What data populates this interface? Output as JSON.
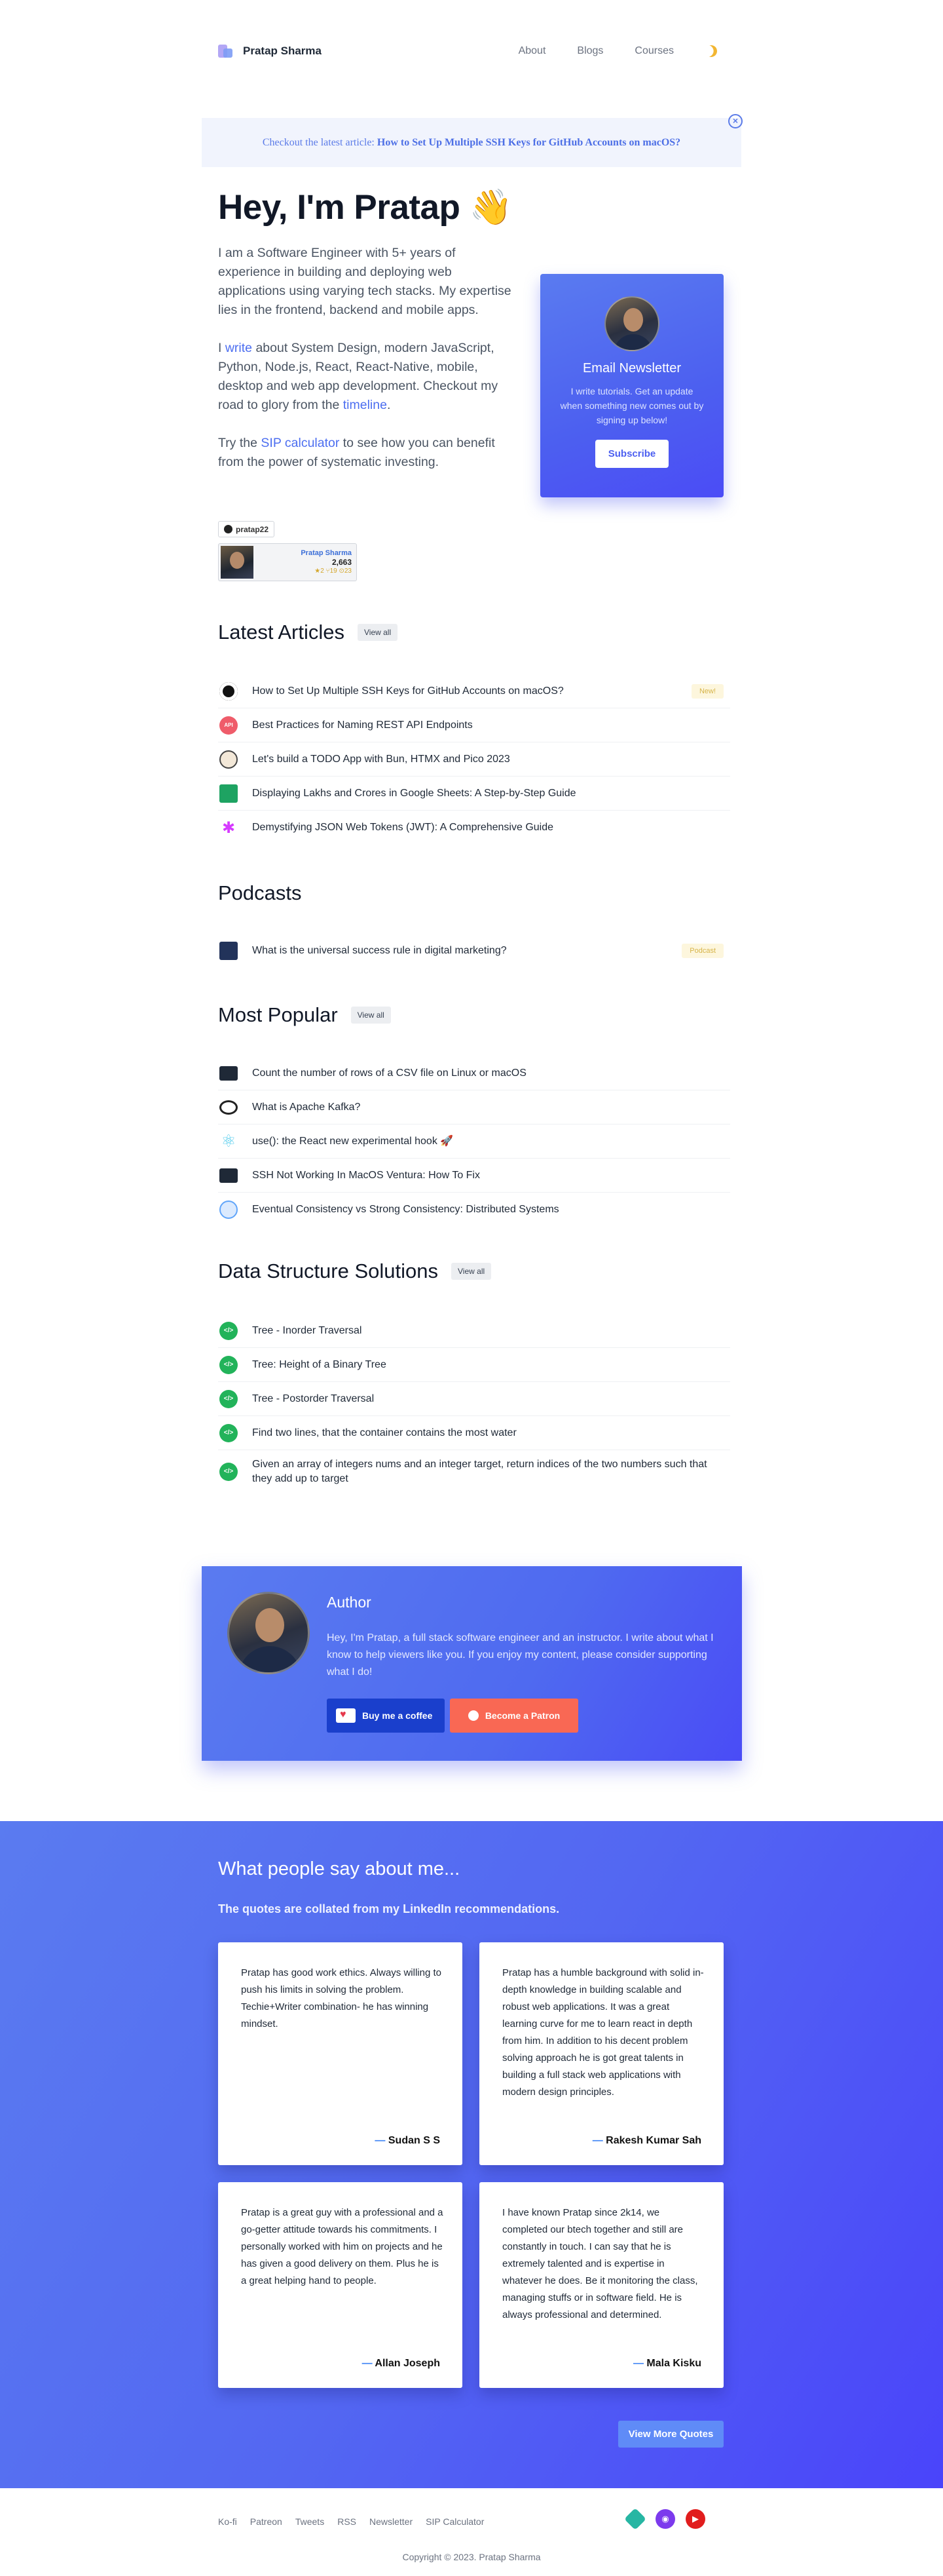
{
  "header": {
    "logo_text": "Pratap Sharma",
    "nav": [
      "About",
      "Blogs",
      "Courses"
    ]
  },
  "banner": {
    "prefix": "Checkout the latest article:",
    "title": "How to Set Up Multiple SSH Keys for GitHub Accounts on macOS?",
    "close": "×"
  },
  "hero": {
    "title": "Hey, I'm Pratap 👋",
    "p1": "I am a Software Engineer with 5+ years of experience in building and deploying web applications using varying tech stacks. My expertise lies in the frontend, backend and mobile apps.",
    "p2_a": "I",
    "p2_link": "write",
    "p2_b": "about System Design, modern JavaScript, Python, Node.js, React, React-Native, mobile, desktop and web app development. Checkout my road to glory from the",
    "p2_link2": "timeline",
    "p2_c": ".",
    "p3_a": "Try the",
    "p3_link": "SIP calculator",
    "p3_b": "to see how you can benefit from the power of systematic investing."
  },
  "github": {
    "tag": "pratap22",
    "name": "Pratap Sharma",
    "count": "2,663",
    "stats": "★2 ⑂19 ⊙23"
  },
  "newsletter": {
    "title": "Email Newsletter",
    "desc": "I write tutorials. Get an update when something new comes out by signing up below!",
    "button": "Subscribe"
  },
  "latest": {
    "title": "Latest Articles",
    "view_all": "View all",
    "items": [
      {
        "text": "How to Set Up Multiple SSH Keys for GitHub Accounts on macOS?",
        "icon": "github-icon",
        "badge": "New!"
      },
      {
        "text": "Best Practices for Naming REST API Endpoints",
        "icon": "api-icon"
      },
      {
        "text": "Let's build a TODO App with Bun, HTMX and Pico 2023",
        "icon": "bun-icon"
      },
      {
        "text": "Displaying Lakhs and Crores in Google Sheets: A Step-by-Step Guide",
        "icon": "google-sheets-icon"
      },
      {
        "text": "Demystifying JSON Web Tokens (JWT): A Comprehensive Guide",
        "icon": "jwt-icon"
      }
    ]
  },
  "podcasts": {
    "title": "Podcasts",
    "items": [
      {
        "text": "What is the universal success rule in digital marketing?",
        "icon": "podcast-icon",
        "badge": "Podcast"
      }
    ]
  },
  "popular": {
    "title": "Most Popular",
    "view_all": "View all",
    "items": [
      {
        "text": "Count the number of rows of a CSV file on Linux or macOS",
        "icon": "terminal-icon"
      },
      {
        "text": "What is Apache Kafka?",
        "icon": "kafka-icon"
      },
      {
        "text": "use(): the React new experimental hook 🚀",
        "icon": "react-icon"
      },
      {
        "text": "SSH Not Working In MacOS Ventura: How To Fix",
        "icon": "terminal-icon"
      },
      {
        "text": "Eventual Consistency vs Strong Consistency: Distributed Systems",
        "icon": "consistency-icon"
      }
    ]
  },
  "dsa": {
    "title": "Data Structure Solutions",
    "view_all": "View all",
    "items": [
      {
        "text": "Tree - Inorder Traversal",
        "icon": "code-icon"
      },
      {
        "text": "Tree: Height of a Binary Tree",
        "icon": "code-icon"
      },
      {
        "text": "Tree - Postorder Traversal",
        "icon": "code-icon"
      },
      {
        "text": "Find two lines, that the container contains the most water",
        "icon": "code-icon"
      },
      {
        "text": "Given an array of integers nums and an integer target, return indices of the two numbers such that they add up to target",
        "icon": "code-icon"
      }
    ]
  },
  "author": {
    "title": "Author",
    "desc": "Hey, I'm Pratap, a full stack software engineer and an instructor. I write about what I know to help viewers like you. If you enjoy my content, please consider supporting what I do!",
    "coffee": "Buy me a coffee",
    "patreon": "Become a Patron"
  },
  "testimonials": {
    "title": "What people say about me...",
    "subtitle": "The quotes are collated from my LinkedIn recommendations.",
    "quotes": [
      {
        "text": "Pratap has good work ethics. Always willing to push his limits in solving the problem. Techie+Writer combination- he has winning mindset.",
        "author": "Sudan S S"
      },
      {
        "text": "Pratap has a humble background with solid in-depth knowledge in building scalable and robust web applications. It was a great learning curve for me to learn react in depth from him. In addition to his decent problem solving approach he is got great talents in building a full stack web applications with modern design principles.",
        "author": "Rakesh Kumar Sah"
      },
      {
        "text": "Pratap is a great guy with a professional and a go-getter attitude towards his commitments. I personally worked with him on projects and he has given a good delivery on them. Plus he is a great helping hand to people.",
        "author": "Allan Joseph"
      },
      {
        "text": "I have known Pratap since 2k14, we completed our btech together and still are constantly in touch. I can say that he is extremely talented and is expertise in whatever he does. Be it monitoring the class, managing stuffs or in software field. He is always professional and determined.",
        "author": "Mala Kisku"
      }
    ],
    "more": "View More Quotes",
    "dash": "—"
  },
  "footer": {
    "links": [
      "Ko-fi",
      "Patreon",
      "Tweets",
      "RSS",
      "Newsletter",
      "SIP Calculator"
    ],
    "copyright": "Copyright © 2023. Pratap Sharma"
  }
}
